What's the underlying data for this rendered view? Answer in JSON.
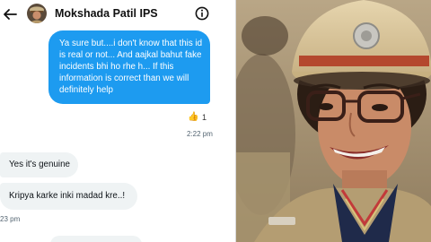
{
  "header": {
    "contact_name": "Mokshada Patil IPS"
  },
  "messages": [
    {
      "direction": "outgoing",
      "text": "Ya sure but....i don't know that this id is real or not... And aajkal bahut fake incidents bhi ho rhe h... If this information is correct than we will definitely help",
      "reaction": {
        "emoji": "👍",
        "count": "1"
      },
      "time": "2:22 pm"
    },
    {
      "direction": "incoming",
      "text": "Yes it's genuine"
    },
    {
      "direction": "incoming",
      "text": "Kripya karke inki madad kre..!",
      "time": "23 pm"
    }
  ],
  "colors": {
    "outgoing_bubble": "#1d9bf0",
    "incoming_bubble": "#eff3f4",
    "timestamp": "#536471"
  },
  "icons": {
    "back": "arrow-left-icon",
    "info": "info-circle-icon",
    "reaction": "thumbs-up-icon"
  }
}
